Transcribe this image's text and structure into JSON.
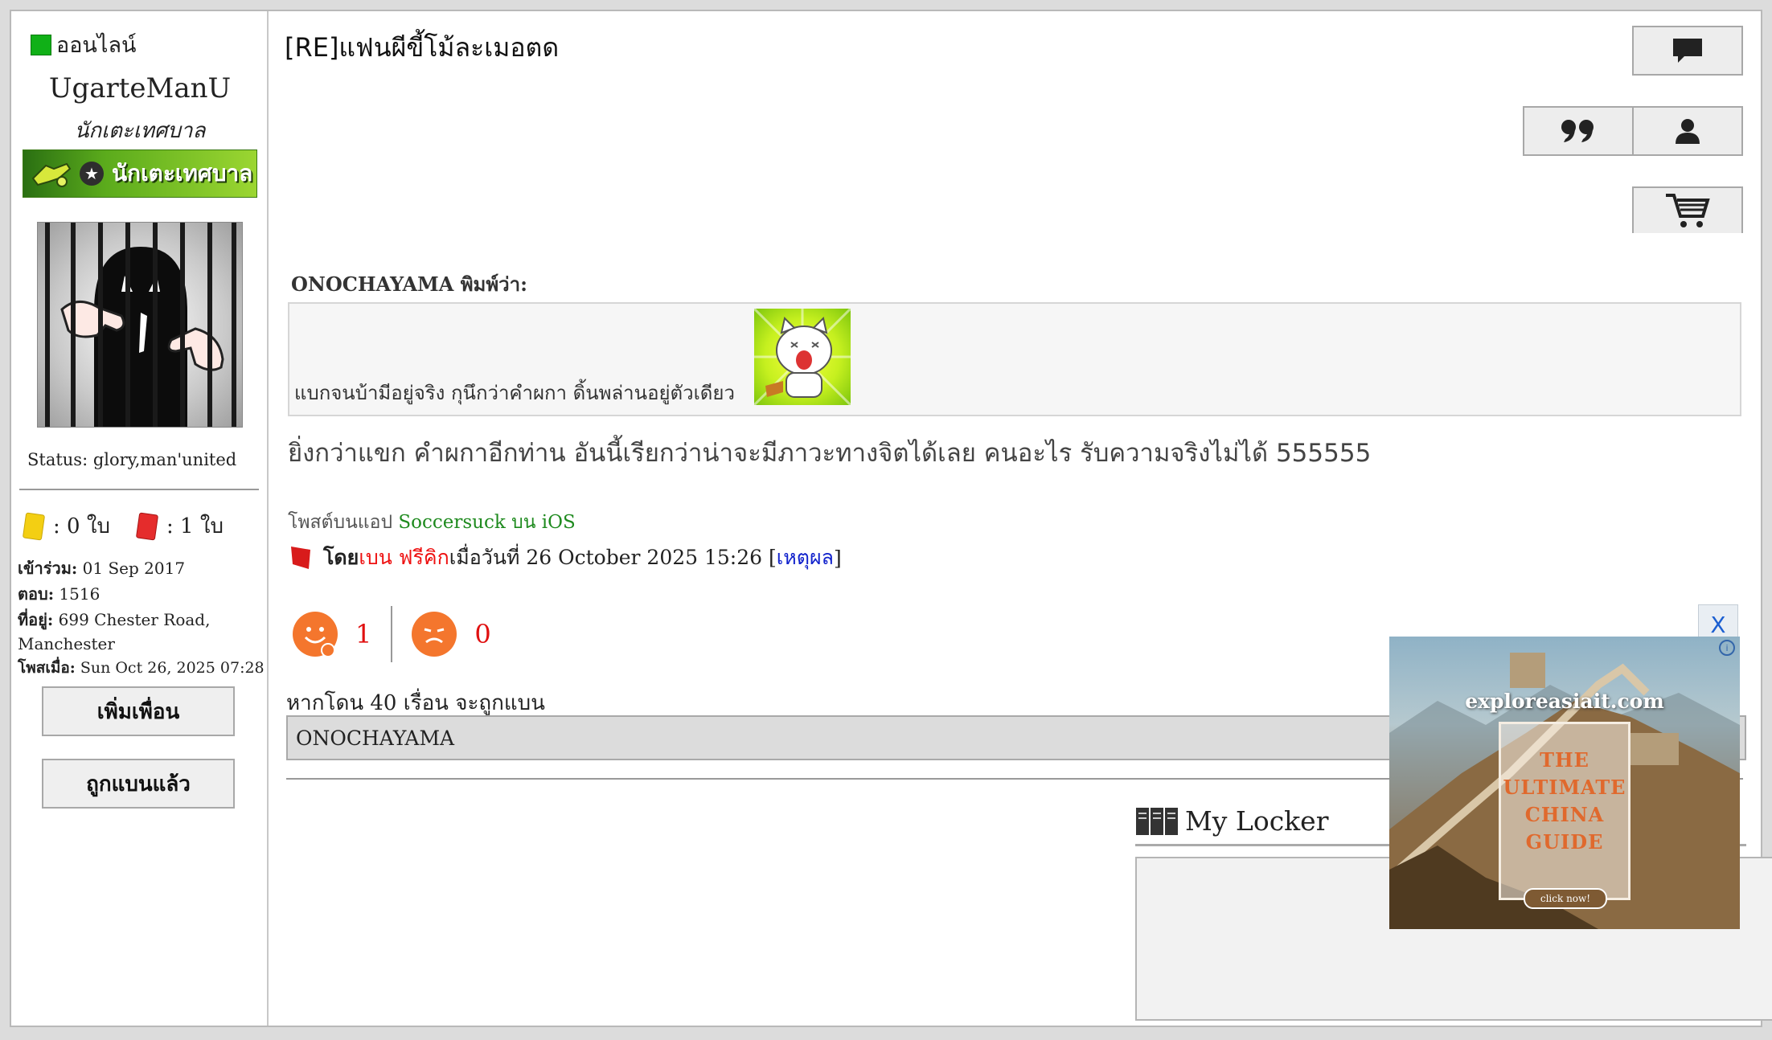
{
  "sidebar": {
    "status_online": "ออนไลน์",
    "username": "UgarteManU",
    "user_title": "นักเตะเทศบาล",
    "rank_badge": "นักเตะเทศบาล",
    "status_line": "Status: glory,man'united",
    "yellow_cards": ": 0 ใบ",
    "red_cards": ": 1 ใบ",
    "joined_label": "เข้าร่วม:",
    "joined_value": " 01 Sep 2017",
    "replies_label": "ตอบ:",
    "replies_value": " 1516",
    "address_label": "ที่อยู่:",
    "address_value": " 699 Chester Road,",
    "address_value2": "Manchester",
    "posted_label": "โพสเมื่อ:",
    "posted_value": " Sun Oct 26, 2025 07:28",
    "add_friend_button": "เพิ่มเพื่อน",
    "banned_button": "ถูกแบนแล้ว"
  },
  "post": {
    "title": "[RE]แฟนผีขี้โม้ละเมอตด",
    "quote_author": "ONOCHAYAMA พิมพ์ว่า:",
    "quote_text": "แบกจนบ้ามีอยู่จริง กุนึกว่าคำผกา ดิ้นพล่านอยู่ตัวเดียว",
    "message": "ยิ่งกว่าแขก คำผกาอีกท่าน อันนี้เรียกว่าน่าจะมีภาวะทางจิตได้เลย คนอะไร รับความจริงไม่ได้ 555555",
    "app_prefix": "โพสต์บนแอป ",
    "app_name": "Soccersuck บน iOS",
    "ban_by": "โดย ",
    "ban_user": "เบน ฟรีคิก",
    "ban_when": " เมื่อวันที่ 26 October 2025 15:26 [",
    "ban_reason_link": "เหตุผล",
    "ban_close": "]",
    "like_count": "1",
    "dislike_count": "0",
    "ban_note": "หากโดน 40 เรื่อน จะถูกแบน",
    "ban_list_text": "ONOCHAYAMA",
    "locker_title": "My Locker"
  },
  "ad": {
    "close_label": "X",
    "domain": "exploreasiait.com",
    "headline_1": "THE",
    "headline_2": "ULTIMATE",
    "headline_3": "CHINA",
    "headline_4": "GUIDE",
    "cta": "click now!"
  },
  "colors": {
    "online_green": "#10b017",
    "link_red": "#e11111",
    "link_blue": "#1122cc",
    "app_green": "#1e8a1e",
    "vote_orange": "#f4762d"
  }
}
